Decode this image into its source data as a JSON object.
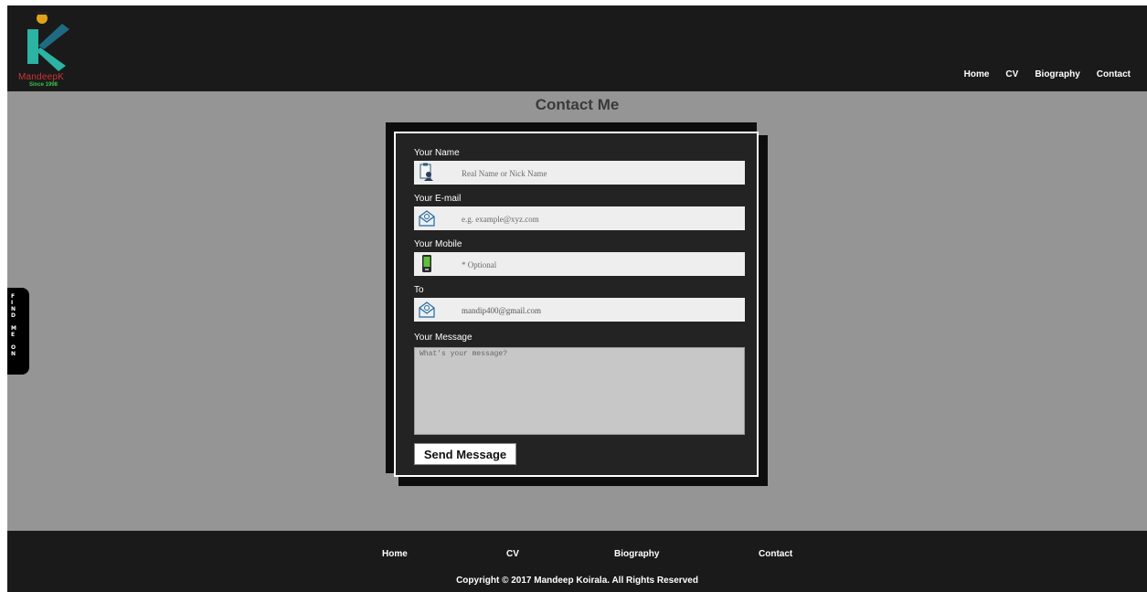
{
  "brand": {
    "name": "MandeepK",
    "since": "Since 1998",
    "colors": {
      "name": "#d03434",
      "since": "#34c54a",
      "logo_k": "#2bb3a3",
      "logo_dark": "#1f6b82"
    }
  },
  "nav": {
    "items": [
      {
        "label": "Home"
      },
      {
        "label": "CV"
      },
      {
        "label": "Biography"
      },
      {
        "label": "Contact"
      }
    ]
  },
  "page_title": "Contact Me",
  "form": {
    "name": {
      "label": "Your Name",
      "placeholder": "Real Name or Nick Name",
      "icon": "id-card-icon"
    },
    "email": {
      "label": "Your E-mail",
      "placeholder": "e.g. example@xyz.com",
      "icon": "mail-icon"
    },
    "mobile": {
      "label": "Your Mobile",
      "placeholder": "* Optional",
      "icon": "phone-icon"
    },
    "to": {
      "label": "To",
      "value": "mandip400@gmail.com",
      "icon": "mail-icon"
    },
    "message": {
      "label": "Your Message",
      "placeholder": "What's your message?"
    },
    "submit_label": "Send Message"
  },
  "side_tab": {
    "text": "F\nI\nN\nD\n\nM\nE\n\nO\nN"
  },
  "footer": {
    "nav": [
      {
        "label": "Home"
      },
      {
        "label": "CV"
      },
      {
        "label": "Biography"
      },
      {
        "label": "Contact"
      }
    ],
    "copyright": "Copyright © 2017 Mandeep Koirala. All Rights Reserved"
  }
}
